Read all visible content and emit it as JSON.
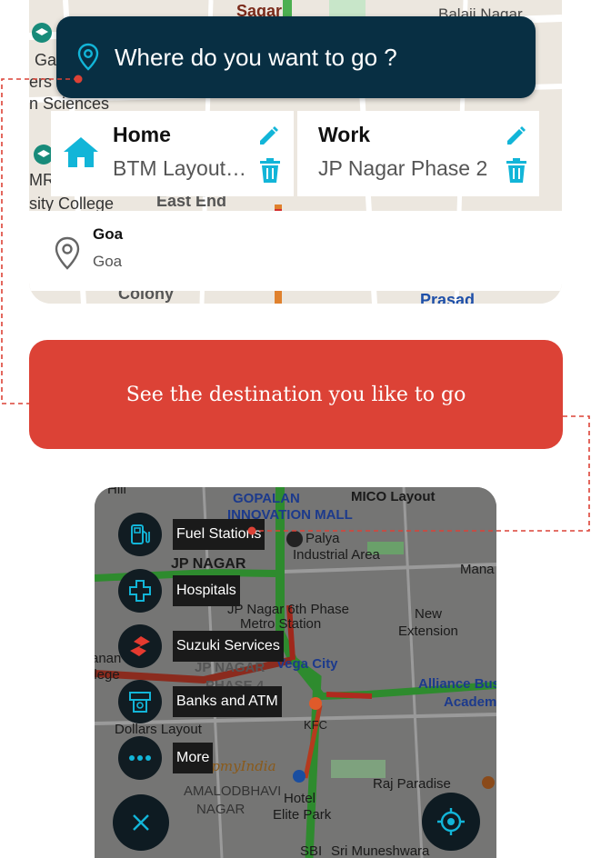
{
  "search": {
    "placeholder": "Where do you want to go ?"
  },
  "saved_places": [
    {
      "title": "Home",
      "address": "BTM Layout, Bengaluru"
    },
    {
      "title": "Work",
      "address": "JP Nagar Phase 2"
    }
  ],
  "recent": {
    "title": "Goa",
    "subtitle": "Goa"
  },
  "banner": {
    "text": "See the destination you like to go"
  },
  "top_map_labels": [
    "Sagar",
    "Balaji Nagar",
    "Ga",
    "ers",
    "n Sciences",
    "MRV",
    "sity College",
    "East End",
    "Colony",
    "Prasad"
  ],
  "bottom_map_labels": [
    "GOPALAN",
    "INNOVATION MALL",
    "MICO Layout",
    "Palya",
    "Industrial Area",
    "JP NAGAR",
    "Mana",
    "JP Nagar 6th Phase",
    "Metro Station",
    "New",
    "Extension",
    "Vega City",
    "JP NAGAR",
    "PHASE 4",
    "Alliance Bus",
    "Academ",
    "Dollars Layout",
    "KFC",
    "MapmyIndia",
    "AMALODBHAVI",
    "NAGAR",
    "Hotel",
    "Elite Park",
    "Raj Paradise",
    "Sri Muneshwara",
    "SBI",
    "Hill",
    "anan",
    "llege"
  ],
  "categories": [
    {
      "label": "Fuel Stations",
      "icon": "fuel-station-icon"
    },
    {
      "label": "Hospitals",
      "icon": "hospital-cross-icon"
    },
    {
      "label": "Suzuki Services",
      "icon": "suzuki-logo-icon"
    },
    {
      "label": "Banks and ATM",
      "icon": "atm-icon"
    },
    {
      "label": "More",
      "icon": "more-dots-icon"
    }
  ],
  "colors": {
    "navy": "#082f43",
    "accent_teal": "#12b5d8",
    "banner_red": "#dc4236",
    "dark_button": "#111c22"
  }
}
